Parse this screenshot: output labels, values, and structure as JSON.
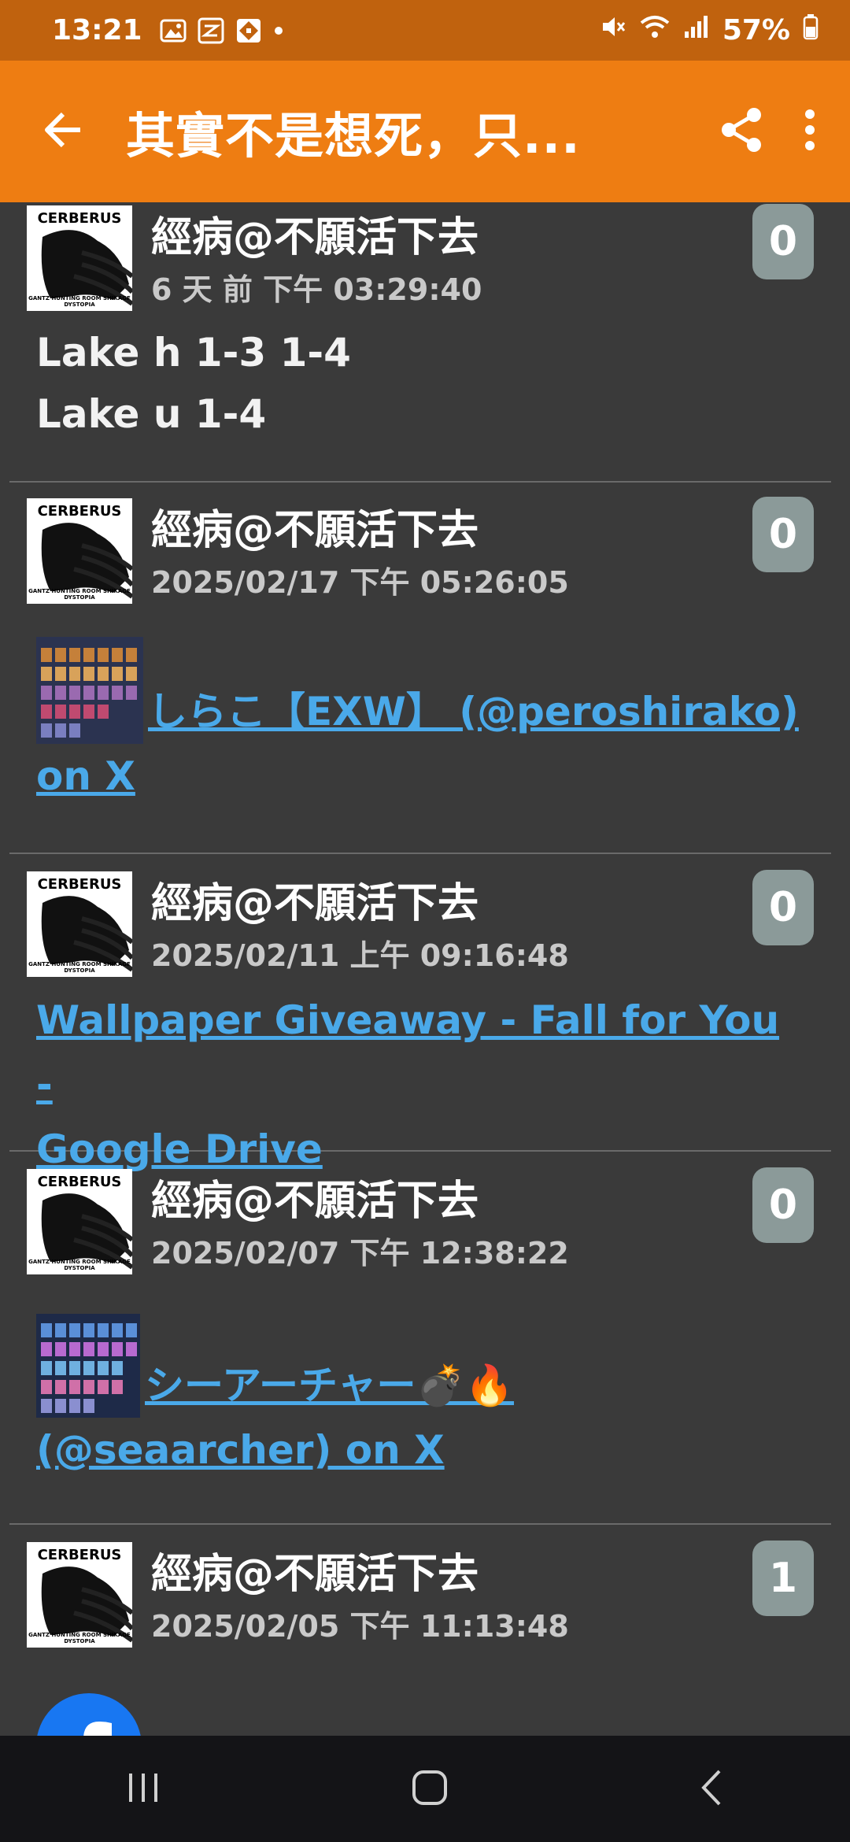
{
  "status_bar": {
    "time": "13:21",
    "battery": "57%",
    "icons": [
      "gallery-icon",
      "app-icon",
      "app-icon-2",
      "dot-icon",
      "mute-icon",
      "wifi-icon",
      "signal-icon",
      "battery-icon"
    ]
  },
  "app_bar": {
    "title": "其實不是想死，只...",
    "back_icon": "arrow-left-icon",
    "share_icon": "share-icon",
    "more_icon": "more-vertical-icon",
    "color": "#ee7d12"
  },
  "avatar": {
    "name": "CERBERUS",
    "footer": "GANTZ HUNTING ROOM  SHIKAGE  DYSTOPIA"
  },
  "posts": [
    {
      "author": "經病@不願活下去",
      "time": "6 天 前 下午 03:29:40",
      "count": "0",
      "text_lines": [
        "Lake h 1-3 1-4",
        "Lake u 1-4"
      ]
    },
    {
      "author": "經病@不願活下去",
      "time": "2025/02/17 下午 05:26:05",
      "count": "0",
      "link_line1": "しらこ【EXW】 (@peroshirako)",
      "link_line2": "on X"
    },
    {
      "author": "經病@不願活下去",
      "time": "2025/02/11 上午 09:16:48",
      "count": "0",
      "link_line1": "Wallpaper Giveaway - Fall for You -",
      "link_line2": "Google Drive"
    },
    {
      "author": "經病@不願活下去",
      "time": "2025/02/07 下午 12:38:22",
      "count": "0",
      "link_line1": "シーアーチャー💣🔥",
      "link_line2": "(@seaarcher) on X"
    },
    {
      "author": "經病@不願活下去",
      "time": "2025/02/05 下午 11:13:48",
      "count": "1"
    }
  ],
  "nav": {
    "recents": "recents-icon",
    "home": "home-icon",
    "back": "back-icon"
  }
}
